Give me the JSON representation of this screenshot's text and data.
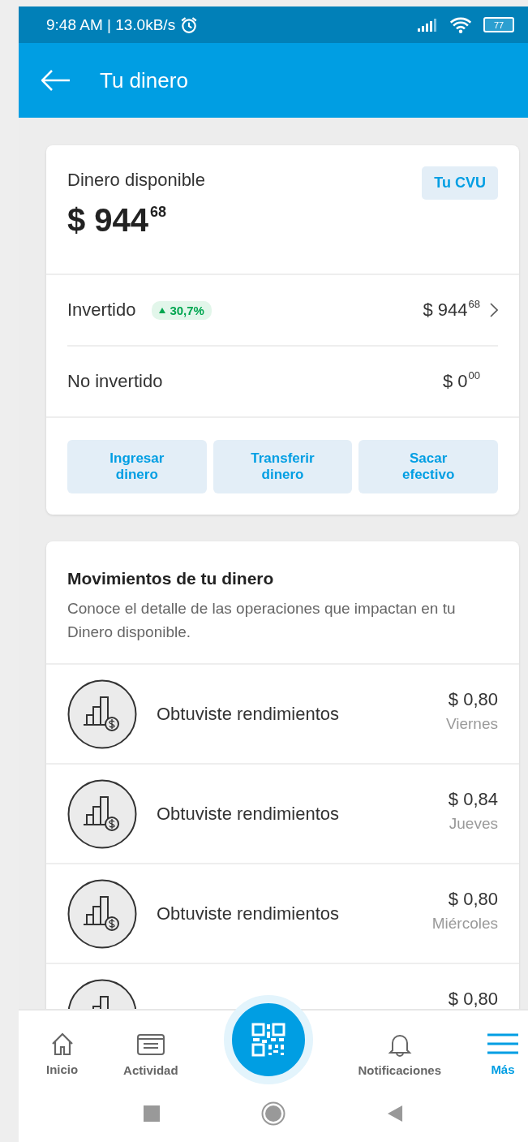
{
  "status_bar": {
    "time": "9:48 AM | 13.0kB/s",
    "battery": "77"
  },
  "app_bar": {
    "title": "Tu dinero"
  },
  "balance_card": {
    "label": "Dinero disponible",
    "cvu_button": "Tu CVU",
    "amount": "$ 944$^{68}$",
    "rows": [
      {
        "label": "Invertido",
        "badge": "30,7%",
        "amount": "$ 944$^{68}$",
        "has_chevron": true
      },
      {
        "label": "No invertido",
        "amount": "$ 0$^{00}$",
        "has_chevron": false
      }
    ],
    "actions": [
      "Ingresar dinero",
      "Transferir dinero",
      "Sacar efectivo"
    ]
  },
  "movements": {
    "title": "Movimientos de tu dinero",
    "description": "Conoce el detalle de las operaciones que impactan en tu Dinero disponible.",
    "items": [
      {
        "label": "Obtuviste rendimientos",
        "amount": "$ 0,80",
        "day": "Viernes"
      },
      {
        "label": "Obtuviste rendimientos",
        "amount": "$ 0,84",
        "day": "Jueves"
      },
      {
        "label": "Obtuviste rendimientos",
        "amount": "$ 0,80",
        "day": "Miércoles"
      },
      {
        "amount": "$ 0,80"
      }
    ]
  },
  "bottom_nav": [
    {
      "kind": "home",
      "label": "Inicio",
      "selected": false
    },
    {
      "kind": "activity",
      "label": "Actividad",
      "selected": false
    },
    {
      "kind": "qr",
      "selected": false
    },
    {
      "kind": "bell",
      "label": "Notificaciones",
      "selected": false
    },
    {
      "kind": "menu",
      "label": "Más",
      "selected": true
    }
  ]
}
